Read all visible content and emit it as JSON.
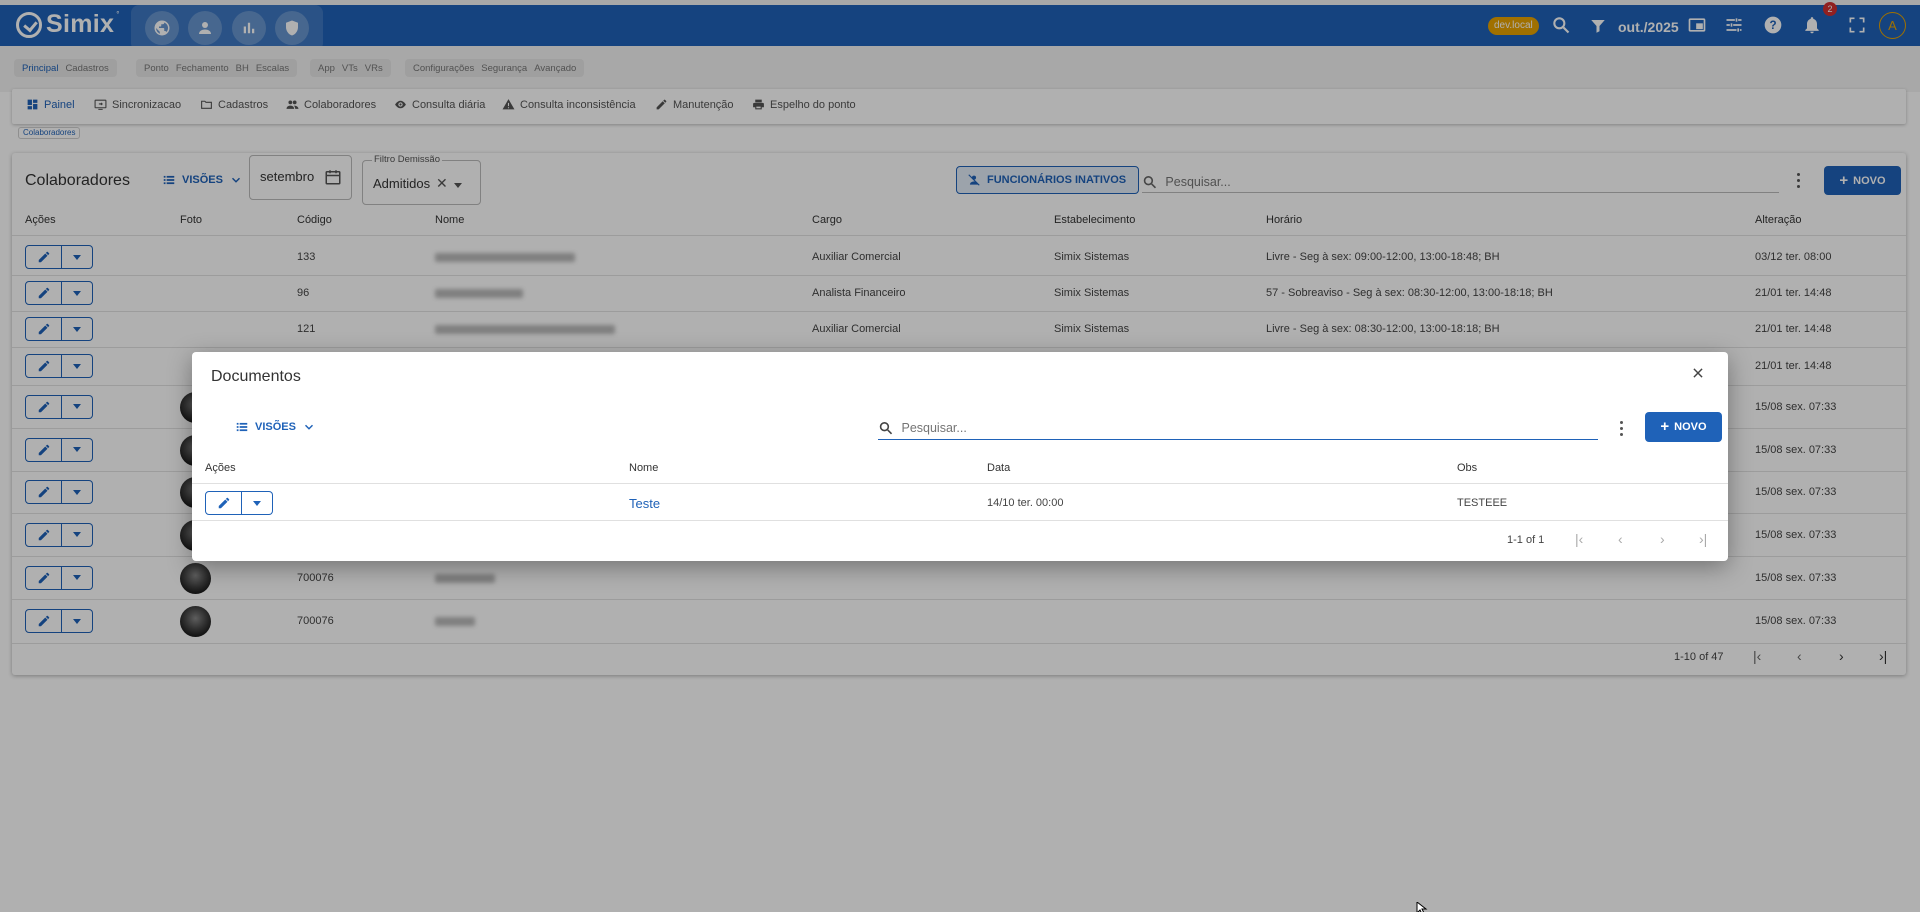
{
  "app": {
    "brand": "Simix",
    "brand_mark": "°",
    "env_badge": "dev.local",
    "period": "out./2025",
    "notifications": "2",
    "user_initial": "A"
  },
  "modules": [
    {
      "items": [
        "Principal",
        "Cadastros"
      ],
      "active": "Principal"
    },
    {
      "items": [
        "Ponto",
        "Fechamento",
        "BH",
        "Escalas"
      ]
    },
    {
      "items": [
        "App",
        "VTs",
        "VRs"
      ]
    },
    {
      "items": [
        "Configurações",
        "Segurança",
        "Avançado"
      ]
    }
  ],
  "nav": {
    "painel": "Painel",
    "sincronizacao": "Sincronizacao",
    "cadastros": "Cadastros",
    "colaboradores": "Colaboradores",
    "consulta_diaria": "Consulta diária",
    "consulta_inconsistencia": "Consulta inconsistência",
    "manutencao": "Manutenção",
    "espelho": "Espelho do ponto"
  },
  "breadcrumb": "Colaboradores",
  "page": {
    "title": "Colaboradores",
    "visoes": "VISÕES",
    "date_value": "setembro",
    "filter_label": "Filtro Demissão",
    "filter_value": "Admitidos",
    "inactive_button": "FUNCIONÁRIOS INATIVOS",
    "search_placeholder": "Pesquisar...",
    "new_button": "NOVO"
  },
  "table": {
    "headers": {
      "acoes": "Ações",
      "foto": "Foto",
      "codigo": "Código",
      "nome": "Nome",
      "cargo": "Cargo",
      "estabelecimento": "Estabelecimento",
      "horario": "Horário",
      "alteracao": "Alteração"
    },
    "rows": [
      {
        "codigo": "133",
        "cargo": "Auxiliar Comercial",
        "estabelecimento": "Simix Sistemas",
        "horario": "Livre - Seg à sex: 09:00-12:00, 13:00-18:48; BH",
        "alteracao": "03/12 ter. 08:00"
      },
      {
        "codigo": "96",
        "cargo": "Analista Financeiro",
        "estabelecimento": "Simix Sistemas",
        "horario": "57 - Sobreaviso - Seg à sex: 08:30-12:00, 13:00-18:18; BH",
        "alteracao": "21/01 ter. 14:48"
      },
      {
        "codigo": "121",
        "cargo": "Auxiliar Comercial",
        "estabelecimento": "Simix Sistemas",
        "horario": "Livre - Seg à sex: 08:30-12:00, 13:00-18:18; BH",
        "alteracao": "21/01 ter. 14:48"
      },
      {
        "codigo": "",
        "cargo": "",
        "estabelecimento": "",
        "horario": "",
        "alteracao": "21/01 ter. 14:48"
      },
      {
        "codigo": "",
        "cargo": "",
        "estabelecimento": "",
        "horario": "",
        "alteracao": "15/08 sex. 07:33"
      },
      {
        "codigo": "",
        "cargo": "",
        "estabelecimento": "",
        "horario": "",
        "alteracao": "15/08 sex. 07:33"
      },
      {
        "codigo": "",
        "cargo": "",
        "estabelecimento": "",
        "horario": "",
        "alteracao": "15/08 sex. 07:33"
      },
      {
        "codigo": "",
        "cargo": "",
        "estabelecimento": "",
        "horario": "",
        "alteracao": "15/08 sex. 07:33"
      },
      {
        "codigo": "700076",
        "cargo": "",
        "estabelecimento": "",
        "horario": "",
        "alteracao": "15/08 sex. 07:33"
      },
      {
        "codigo": "700076",
        "cargo": "",
        "estabelecimento": "",
        "horario": "",
        "alteracao": "15/08 sex. 07:33"
      }
    ],
    "pagination": "1-10 of 47"
  },
  "dialog": {
    "title": "Documentos",
    "visoes": "VISÕES",
    "search_placeholder": "Pesquisar...",
    "new_button": "NOVO",
    "headers": {
      "acoes": "Ações",
      "nome": "Nome",
      "data": "Data",
      "obs": "Obs"
    },
    "rows": [
      {
        "nome": "Teste",
        "data": "14/10 ter. 00:00",
        "obs": "TESTEEE"
      }
    ],
    "pagination": "1-1 of 1"
  },
  "colors": {
    "primary": "#1f62b8",
    "env_badge": "#e8a300",
    "notification": "#d32f2f",
    "overlay": "rgba(0,0,0,0.31)"
  },
  "icons": [
    "globe-icon",
    "person-icon",
    "bar-chart-icon",
    "shield-icon",
    "search-icon",
    "filter-icon",
    "picture-in-picture-icon",
    "tune-icon",
    "help-icon",
    "bell-icon",
    "fullscreen-icon",
    "calendar-icon",
    "pencil-icon",
    "close-icon"
  ]
}
